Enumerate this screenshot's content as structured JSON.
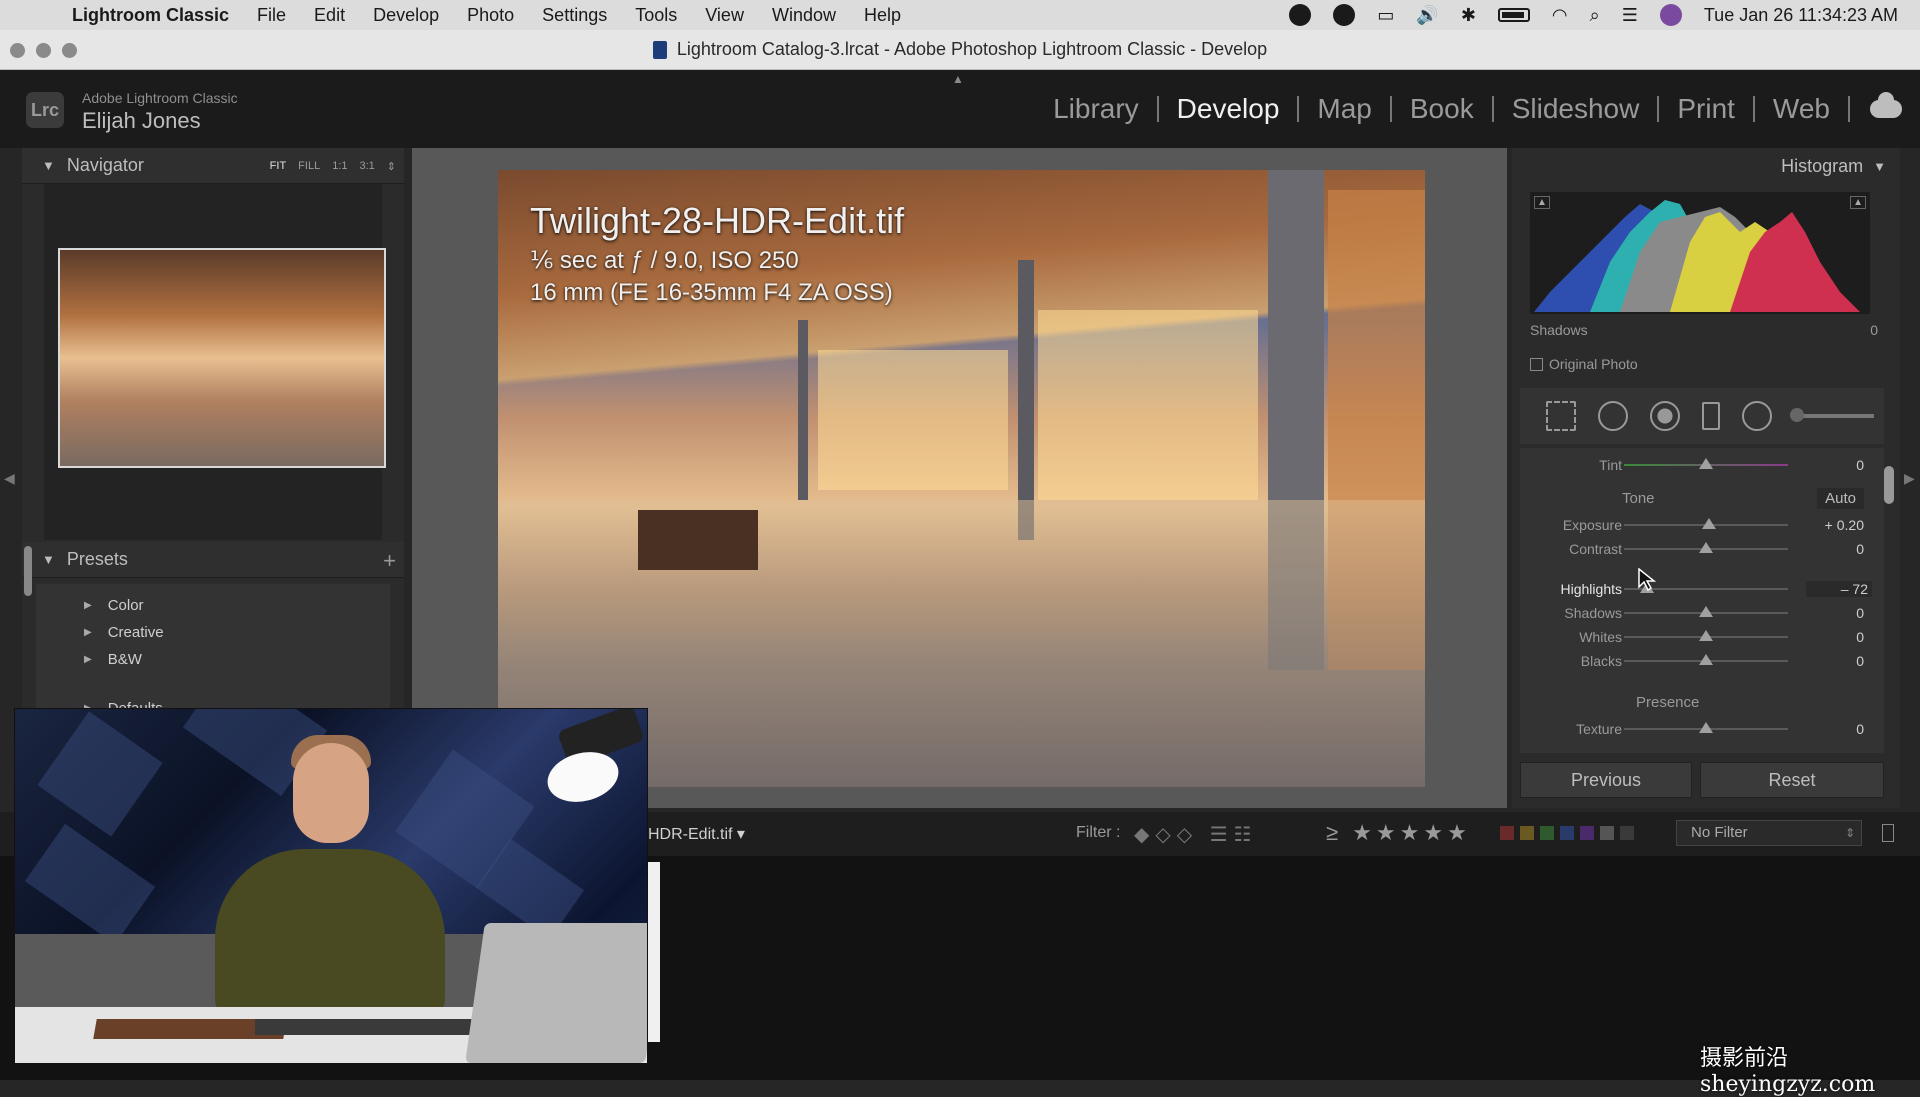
{
  "menubar": {
    "app_name": "Lightroom Classic",
    "items": [
      "File",
      "Edit",
      "Develop",
      "Photo",
      "Settings",
      "Tools",
      "View",
      "Window",
      "Help"
    ],
    "clock": "Tue Jan 26  11:34:23 AM"
  },
  "window": {
    "title": "Lightroom Catalog-3.lrcat - Adobe Photoshop Lightroom Classic - Develop"
  },
  "header": {
    "logo": "Lrc",
    "brand": "Adobe Lightroom Classic",
    "user": "Elijah Jones",
    "modules": [
      "Library",
      "Develop",
      "Map",
      "Book",
      "Slideshow",
      "Print",
      "Web"
    ],
    "active_module": "Develop"
  },
  "navigator": {
    "title": "Navigator",
    "zoom": [
      "FIT",
      "FILL",
      "1:1",
      "3:1"
    ],
    "zoom_active": "FIT"
  },
  "presets": {
    "title": "Presets",
    "add_label": "+",
    "items": [
      "Color",
      "Creative",
      "B&W",
      "Defaults"
    ]
  },
  "photo": {
    "filename": "Twilight-28-HDR-Edit.tif",
    "exposure_info": "⅙ sec at ƒ / 9.0, ISO 250",
    "lens_info": "16 mm (FE 16-35mm F4 ZA OSS)"
  },
  "histogram": {
    "title": "Histogram",
    "readout_label": "Shadows",
    "readout_value": "0",
    "original_photo_label": "Original Photo"
  },
  "basic": {
    "tint": {
      "label": "Tint",
      "value": "0"
    },
    "tone_title": "Tone",
    "auto_label": "Auto",
    "sliders": [
      {
        "label": "Exposure",
        "value": "+ 0.20"
      },
      {
        "label": "Contrast",
        "value": "0"
      },
      {
        "label": "Highlights",
        "value": "– 72"
      },
      {
        "label": "Shadows",
        "value": "0"
      },
      {
        "label": "Whites",
        "value": "0"
      },
      {
        "label": "Blacks",
        "value": "0"
      }
    ],
    "presence_title": "Presence",
    "texture": {
      "label": "Texture",
      "value": "0"
    }
  },
  "buttons": {
    "previous": "Previous",
    "reset": "Reset"
  },
  "filmstrip": {
    "filename": "HDR-Edit.tif ▾",
    "filter_label": "Filter :",
    "rating_prefix": "≥",
    "stars": "★★★★★",
    "filter_select": "No Filter",
    "swatch_colors": [
      "#6a2a2a",
      "#6a5a22",
      "#2e5a2e",
      "#2a3a6a",
      "#4a2a6a",
      "#555555",
      "#3a3a3a"
    ]
  },
  "watermark": "摄影前沿 sheyingzyz.com"
}
